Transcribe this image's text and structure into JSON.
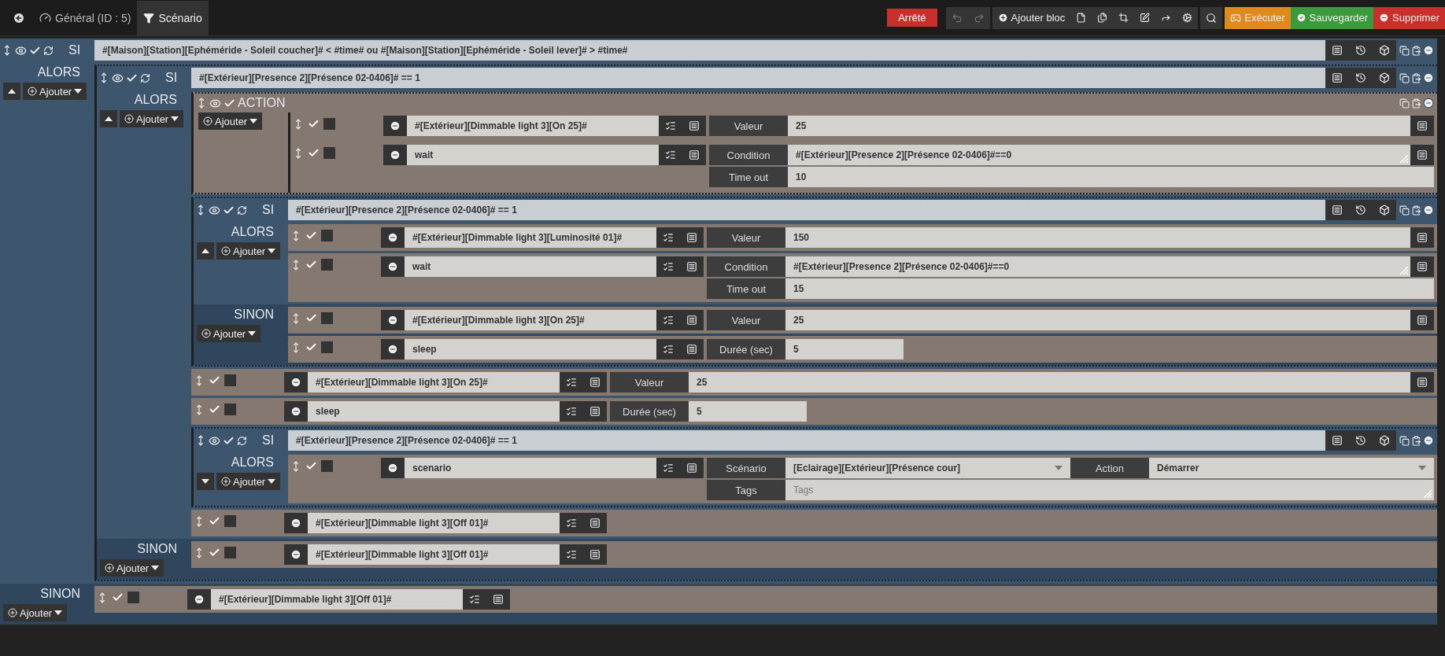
{
  "topbar": {
    "tabs": [
      {
        "label": "Général (ID : 5)",
        "selected": false
      },
      {
        "label": "Scénario",
        "selected": true
      }
    ],
    "status": "Arrêté",
    "undo": {
      "disabled": true
    },
    "redo": {
      "disabled": true
    },
    "add_block": "Ajouter bloc",
    "run": "Exécuter",
    "save": "Sauvegarder",
    "delete": "Supprimer"
  },
  "scenario": {
    "kind": "if",
    "label": "SI",
    "condition": "#[Maison][Station][Ephéméride - Soleil coucher]# < #time#  ou #[Maison][Station][Ephéméride - Soleil lever]# > #time#",
    "then_label": "ALORS",
    "then_add": "Ajouter",
    "sort_up": true,
    "then": [
      {
        "kind": "if",
        "label": "SI",
        "condition": "#[Extérieur][Presence 2][Présence 02-0406]# == 1",
        "then_label": "ALORS",
        "then_add": "Ajouter",
        "sort_up": true,
        "then": [
          {
            "kind": "action",
            "label": "ACTION",
            "add": "Ajouter",
            "actions": [
              {
                "kind": "command",
                "enabled": true,
                "parallel": false,
                "command": "#[Extérieur][Dimmable light 3][On 25]#",
                "options": [
                  [
                    {
                      "kind": "value",
                      "label": "Valeur",
                      "value": "25"
                    }
                  ]
                ]
              },
              {
                "kind": "command",
                "enabled": true,
                "parallel": false,
                "command": "wait",
                "options": [
                  [
                    {
                      "kind": "condition",
                      "label": "Condition",
                      "value": "#[Extérieur][Presence 2][Présence 02-0406]#==0"
                    }
                  ],
                  [
                    {
                      "kind": "text",
                      "label": "Time out",
                      "value": "10"
                    }
                  ]
                ]
              }
            ]
          },
          {
            "kind": "if",
            "label": "SI",
            "condition": "#[Extérieur][Presence 2][Présence 02-0406]# == 1",
            "then_label": "ALORS",
            "then_add": "Ajouter",
            "sort_up": true,
            "then": [
              {
                "kind": "command",
                "enabled": true,
                "parallel": false,
                "command": "#[Extérieur][Dimmable light 3][Luminosité 01]#",
                "options": [
                  [
                    {
                      "kind": "value",
                      "label": "Valeur",
                      "value": "150"
                    }
                  ]
                ]
              },
              {
                "kind": "command",
                "enabled": true,
                "parallel": false,
                "command": "wait",
                "options": [
                  [
                    {
                      "kind": "condition",
                      "label": "Condition",
                      "value": "#[Extérieur][Presence 2][Présence 02-0406]#==0"
                    }
                  ],
                  [
                    {
                      "kind": "text",
                      "label": "Time out",
                      "value": "15"
                    }
                  ]
                ]
              }
            ],
            "else_label": "SINON",
            "else_add": "Ajouter",
            "else": [
              {
                "kind": "command",
                "enabled": true,
                "parallel": false,
                "command": "#[Extérieur][Dimmable light 3][On 25]#",
                "options": [
                  [
                    {
                      "kind": "value",
                      "label": "Valeur",
                      "value": "25"
                    }
                  ]
                ]
              },
              {
                "kind": "command",
                "enabled": true,
                "parallel": false,
                "command": "sleep",
                "options": [
                  [
                    {
                      "kind": "short",
                      "label": "Durée (sec)",
                      "value": "5"
                    }
                  ]
                ]
              }
            ]
          },
          {
            "kind": "command",
            "enabled": true,
            "parallel": false,
            "command": "#[Extérieur][Dimmable light 3][On 25]#",
            "options": [
              [
                {
                  "kind": "value",
                  "label": "Valeur",
                  "value": "25"
                }
              ]
            ]
          },
          {
            "kind": "command",
            "enabled": true,
            "parallel": false,
            "command": "sleep",
            "options": [
              [
                {
                  "kind": "short",
                  "label": "Durée (sec)",
                  "value": "5"
                }
              ]
            ]
          },
          {
            "kind": "if",
            "label": "SI",
            "condition": "#[Extérieur][Presence 2][Présence 02-0406]# == 1",
            "then_label": "ALORS",
            "then_add": "Ajouter",
            "sort_up": false,
            "then": [
              {
                "kind": "command",
                "enabled": true,
                "parallel": false,
                "command": "scenario",
                "options": [
                  [
                    {
                      "kind": "select",
                      "label": "Scénario",
                      "value": "[Eclairage][Extérieur][Présence cour]"
                    },
                    {
                      "kind": "select",
                      "label": "Action",
                      "value": "Démarrer"
                    }
                  ],
                  [
                    {
                      "kind": "area",
                      "label": "Tags",
                      "placeholder": "Tags"
                    }
                  ]
                ]
              }
            ]
          },
          {
            "kind": "command",
            "enabled": true,
            "parallel": false,
            "command": "#[Extérieur][Dimmable light 3][Off 01]#"
          }
        ],
        "else_label": "SINON",
        "else_add": "Ajouter",
        "else": [
          {
            "kind": "command",
            "enabled": true,
            "parallel": false,
            "command": "#[Extérieur][Dimmable light 3][Off 01]#"
          }
        ]
      }
    ],
    "else_label": "SINON",
    "else_add": "Ajouter",
    "else": [
      {
        "kind": "command",
        "enabled": true,
        "parallel": false,
        "command": "#[Extérieur][Dimmable light 3][Off 01]#"
      }
    ]
  }
}
